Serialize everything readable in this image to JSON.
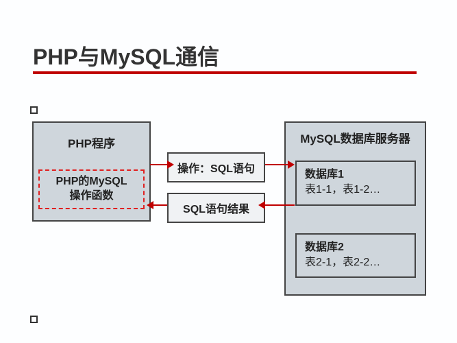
{
  "title": "PHP与MySQL通信",
  "php_box": {
    "title": "PHP程序",
    "inner_label_line1": "PHP的MySQL",
    "inner_label_line2": "操作函数"
  },
  "mysql_box": {
    "title": "MySQL数据库服务器",
    "db1_name": "数据库1",
    "db1_tables": "表1-1，表1-2…",
    "db2_name": "数据库2",
    "db2_tables": "表2-1，表2-2…"
  },
  "operations": {
    "send": "操作：SQL语句",
    "receive": "SQL语句结果"
  }
}
